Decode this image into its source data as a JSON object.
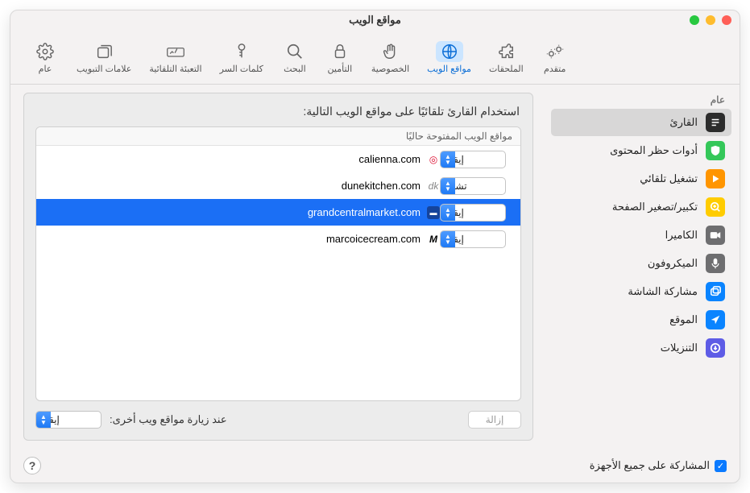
{
  "window": {
    "title": "مواقع الويب"
  },
  "toolbar": [
    {
      "id": "general",
      "label": "عام"
    },
    {
      "id": "tabs",
      "label": "علامات التبويب"
    },
    {
      "id": "autofill",
      "label": "التعبئة التلقائية"
    },
    {
      "id": "passwords",
      "label": "كلمات السر"
    },
    {
      "id": "search",
      "label": "البحث"
    },
    {
      "id": "security",
      "label": "التأمين"
    },
    {
      "id": "privacy",
      "label": "الخصوصية"
    },
    {
      "id": "websites",
      "label": "مواقع الويب",
      "selected": true
    },
    {
      "id": "extensions",
      "label": "الملحقات"
    },
    {
      "id": "advanced",
      "label": "متقدم"
    }
  ],
  "sidebar": {
    "header": "عام",
    "items": [
      {
        "id": "reader",
        "label": "القارئ",
        "selected": true
      },
      {
        "id": "content-blockers",
        "label": "أدوات حظر المحتوى"
      },
      {
        "id": "autoplay",
        "label": "تشغيل تلقائي"
      },
      {
        "id": "page-zoom",
        "label": "تكبير/تصغير الصفحة"
      },
      {
        "id": "camera",
        "label": "الكاميرا"
      },
      {
        "id": "microphone",
        "label": "الميكروفون"
      },
      {
        "id": "screen-sharing",
        "label": "مشاركة الشاشة"
      },
      {
        "id": "location",
        "label": "الموقع"
      },
      {
        "id": "downloads",
        "label": "التنزيلات"
      }
    ]
  },
  "panel": {
    "title": "استخدام القارئ تلقائيًا على مواقع الويب التالية:",
    "table_header": "مواقع الويب المفتوحة حاليًا",
    "rows": [
      {
        "site": "calienna.com",
        "value": "إيقاف",
        "selected": false
      },
      {
        "site": "dunekitchen.com",
        "value": "تشغيل",
        "selected": false
      },
      {
        "site": "grandcentralmarket.com",
        "value": "إيقاف",
        "selected": true
      },
      {
        "site": "marcoicecream.com",
        "value": "إيقاف",
        "selected": false
      }
    ],
    "remove_label": "إزالة",
    "other_sites_label": "عند زيارة مواقع ويب أخرى:",
    "other_sites_value": "إيقاف",
    "select_options": [
      "تشغيل",
      "إيقاف"
    ]
  },
  "footer": {
    "share_label": "المشاركة على جميع الأجهزة",
    "share_checked": true
  }
}
